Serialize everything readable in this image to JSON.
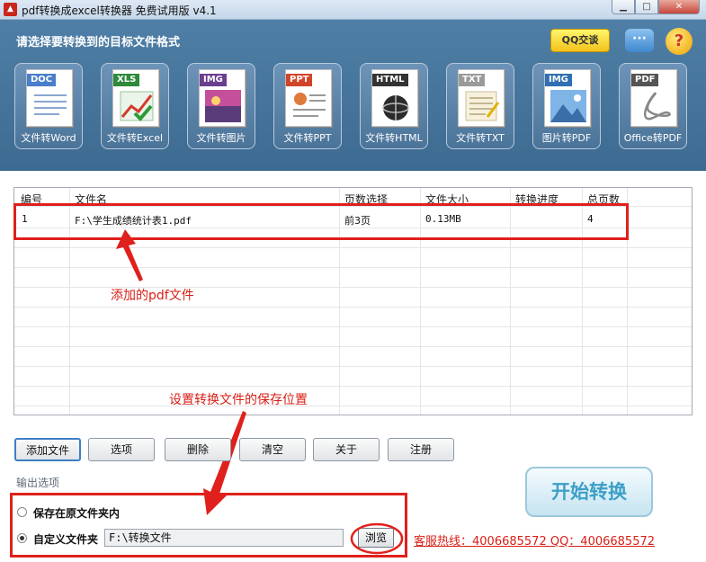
{
  "window": {
    "title": "pdf转换成excel转换器 免费试用版 v4.1"
  },
  "header": {
    "title": "请选择要转换到的目标文件格式",
    "qq_button": "QQ交谈",
    "chat_icon": "speech-bubble-icon",
    "help_icon": "question-icon"
  },
  "formats": [
    {
      "tag": "DOC",
      "label": "文件转Word",
      "color": "#4a7fcb"
    },
    {
      "tag": "XLS",
      "label": "文件转Excel",
      "color": "#2f8a3b"
    },
    {
      "tag": "IMG",
      "label": "文件转图片",
      "color": "#6b3f8f"
    },
    {
      "tag": "PPT",
      "label": "文件转PPT",
      "color": "#d2442a"
    },
    {
      "tag": "HTML",
      "label": "文件转HTML",
      "color": "#333333"
    },
    {
      "tag": "TXT",
      "label": "文件转TXT",
      "color": "#9a9a9a"
    },
    {
      "tag": "IMG",
      "label": "图片转PDF",
      "color": "#2f6fb2"
    },
    {
      "tag": "PDF",
      "label": "Office转PDF",
      "color": "#555555"
    }
  ],
  "table": {
    "columns": [
      "编号",
      "文件名",
      "页数选择",
      "文件大小",
      "转换进度",
      "总页数"
    ],
    "rows": [
      {
        "index": "1",
        "filename": "F:\\学生成绩统计表1.pdf",
        "pages": "前3页",
        "size": "0.13MB",
        "progress": "",
        "total": "4"
      }
    ]
  },
  "annotations": {
    "added_file": "添加的pdf文件",
    "save_location": "设置转换文件的保存位置"
  },
  "buttons": {
    "add_file": "添加文件",
    "options": "选项",
    "delete": "删除",
    "clear": "清空",
    "about": "关于",
    "register": "注册"
  },
  "output": {
    "label": "输出选项",
    "option_same_folder": "保存在原文件夹内",
    "option_custom_folder": "自定义文件夹",
    "custom_path": "F:\\转换文件",
    "browse_label": "浏览",
    "selected_option": "custom"
  },
  "start_button": "开始转换",
  "hotline": "客服热线：4006685572 QQ：4006685572",
  "colors": {
    "header_bg": "#456f96",
    "annotation_red": "#d81e16",
    "start_text": "#3d9fc8"
  }
}
